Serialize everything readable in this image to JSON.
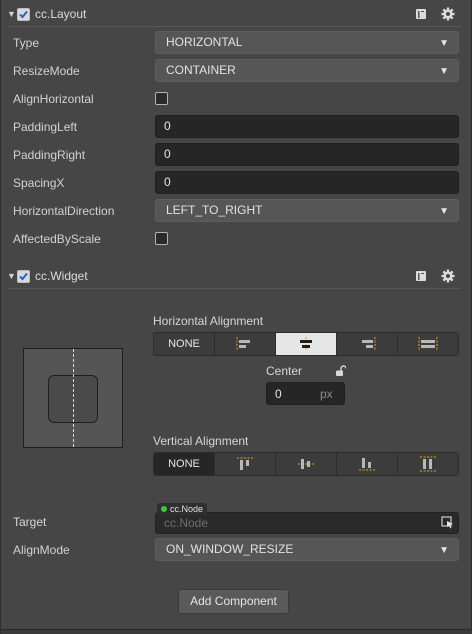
{
  "layout_component": {
    "title": "cc.Layout",
    "enabled": true,
    "props": [
      {
        "label": "Type",
        "kind": "select",
        "value": "HORIZONTAL"
      },
      {
        "label": "ResizeMode",
        "kind": "select",
        "value": "CONTAINER"
      },
      {
        "label": "AlignHorizontal",
        "kind": "checkbox",
        "checked": false
      },
      {
        "label": "PaddingLeft",
        "kind": "input",
        "value": "0"
      },
      {
        "label": "PaddingRight",
        "kind": "input",
        "value": "0"
      },
      {
        "label": "SpacingX",
        "kind": "input",
        "value": "0"
      },
      {
        "label": "HorizontalDirection",
        "kind": "select",
        "value": "LEFT_TO_RIGHT"
      },
      {
        "label": "AffectedByScale",
        "kind": "checkbox",
        "checked": false
      }
    ]
  },
  "widget_component": {
    "title": "cc.Widget",
    "enabled": true,
    "horizontal_alignment": {
      "label": "Horizontal Alignment",
      "none_label": "NONE",
      "selected": "center"
    },
    "center": {
      "label": "Center",
      "value": "0",
      "unit": "px"
    },
    "vertical_alignment": {
      "label": "Vertical Alignment",
      "none_label": "NONE",
      "selected": "none"
    },
    "target": {
      "label": "Target",
      "tag": "cc.Node",
      "placeholder": "cc.Node"
    },
    "align_mode": {
      "label": "AlignMode",
      "value": "ON_WINDOW_RESIZE"
    }
  },
  "add_component_label": "Add Component",
  "icons": {
    "collapse": "triangle-down-icon",
    "help": "book-icon",
    "settings": "gear-icon",
    "lock": "unlock-icon",
    "pick": "node-picker-icon"
  },
  "colors": {
    "background": "#464646",
    "input_dark": "#262626",
    "select_bg": "#565656",
    "active_segment": "#e6e6e6",
    "node_dot": "#3fc43f"
  }
}
